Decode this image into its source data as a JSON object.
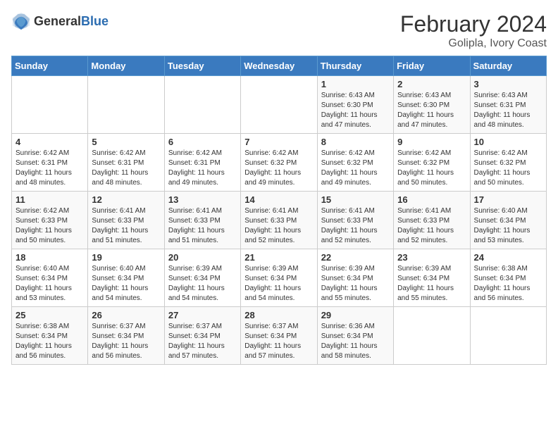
{
  "logo": {
    "general": "General",
    "blue": "Blue"
  },
  "title": "February 2024",
  "subtitle": "Golipla, Ivory Coast",
  "days_of_week": [
    "Sunday",
    "Monday",
    "Tuesday",
    "Wednesday",
    "Thursday",
    "Friday",
    "Saturday"
  ],
  "weeks": [
    [
      {
        "day": "",
        "sunrise": "",
        "sunset": "",
        "daylight": ""
      },
      {
        "day": "",
        "sunrise": "",
        "sunset": "",
        "daylight": ""
      },
      {
        "day": "",
        "sunrise": "",
        "sunset": "",
        "daylight": ""
      },
      {
        "day": "",
        "sunrise": "",
        "sunset": "",
        "daylight": ""
      },
      {
        "day": "1",
        "sunrise": "Sunrise: 6:43 AM",
        "sunset": "Sunset: 6:30 PM",
        "daylight": "Daylight: 11 hours and 47 minutes."
      },
      {
        "day": "2",
        "sunrise": "Sunrise: 6:43 AM",
        "sunset": "Sunset: 6:30 PM",
        "daylight": "Daylight: 11 hours and 47 minutes."
      },
      {
        "day": "3",
        "sunrise": "Sunrise: 6:43 AM",
        "sunset": "Sunset: 6:31 PM",
        "daylight": "Daylight: 11 hours and 48 minutes."
      }
    ],
    [
      {
        "day": "4",
        "sunrise": "Sunrise: 6:42 AM",
        "sunset": "Sunset: 6:31 PM",
        "daylight": "Daylight: 11 hours and 48 minutes."
      },
      {
        "day": "5",
        "sunrise": "Sunrise: 6:42 AM",
        "sunset": "Sunset: 6:31 PM",
        "daylight": "Daylight: 11 hours and 48 minutes."
      },
      {
        "day": "6",
        "sunrise": "Sunrise: 6:42 AM",
        "sunset": "Sunset: 6:31 PM",
        "daylight": "Daylight: 11 hours and 49 minutes."
      },
      {
        "day": "7",
        "sunrise": "Sunrise: 6:42 AM",
        "sunset": "Sunset: 6:32 PM",
        "daylight": "Daylight: 11 hours and 49 minutes."
      },
      {
        "day": "8",
        "sunrise": "Sunrise: 6:42 AM",
        "sunset": "Sunset: 6:32 PM",
        "daylight": "Daylight: 11 hours and 49 minutes."
      },
      {
        "day": "9",
        "sunrise": "Sunrise: 6:42 AM",
        "sunset": "Sunset: 6:32 PM",
        "daylight": "Daylight: 11 hours and 50 minutes."
      },
      {
        "day": "10",
        "sunrise": "Sunrise: 6:42 AM",
        "sunset": "Sunset: 6:32 PM",
        "daylight": "Daylight: 11 hours and 50 minutes."
      }
    ],
    [
      {
        "day": "11",
        "sunrise": "Sunrise: 6:42 AM",
        "sunset": "Sunset: 6:33 PM",
        "daylight": "Daylight: 11 hours and 50 minutes."
      },
      {
        "day": "12",
        "sunrise": "Sunrise: 6:41 AM",
        "sunset": "Sunset: 6:33 PM",
        "daylight": "Daylight: 11 hours and 51 minutes."
      },
      {
        "day": "13",
        "sunrise": "Sunrise: 6:41 AM",
        "sunset": "Sunset: 6:33 PM",
        "daylight": "Daylight: 11 hours and 51 minutes."
      },
      {
        "day": "14",
        "sunrise": "Sunrise: 6:41 AM",
        "sunset": "Sunset: 6:33 PM",
        "daylight": "Daylight: 11 hours and 52 minutes."
      },
      {
        "day": "15",
        "sunrise": "Sunrise: 6:41 AM",
        "sunset": "Sunset: 6:33 PM",
        "daylight": "Daylight: 11 hours and 52 minutes."
      },
      {
        "day": "16",
        "sunrise": "Sunrise: 6:41 AM",
        "sunset": "Sunset: 6:33 PM",
        "daylight": "Daylight: 11 hours and 52 minutes."
      },
      {
        "day": "17",
        "sunrise": "Sunrise: 6:40 AM",
        "sunset": "Sunset: 6:34 PM",
        "daylight": "Daylight: 11 hours and 53 minutes."
      }
    ],
    [
      {
        "day": "18",
        "sunrise": "Sunrise: 6:40 AM",
        "sunset": "Sunset: 6:34 PM",
        "daylight": "Daylight: 11 hours and 53 minutes."
      },
      {
        "day": "19",
        "sunrise": "Sunrise: 6:40 AM",
        "sunset": "Sunset: 6:34 PM",
        "daylight": "Daylight: 11 hours and 54 minutes."
      },
      {
        "day": "20",
        "sunrise": "Sunrise: 6:39 AM",
        "sunset": "Sunset: 6:34 PM",
        "daylight": "Daylight: 11 hours and 54 minutes."
      },
      {
        "day": "21",
        "sunrise": "Sunrise: 6:39 AM",
        "sunset": "Sunset: 6:34 PM",
        "daylight": "Daylight: 11 hours and 54 minutes."
      },
      {
        "day": "22",
        "sunrise": "Sunrise: 6:39 AM",
        "sunset": "Sunset: 6:34 PM",
        "daylight": "Daylight: 11 hours and 55 minutes."
      },
      {
        "day": "23",
        "sunrise": "Sunrise: 6:39 AM",
        "sunset": "Sunset: 6:34 PM",
        "daylight": "Daylight: 11 hours and 55 minutes."
      },
      {
        "day": "24",
        "sunrise": "Sunrise: 6:38 AM",
        "sunset": "Sunset: 6:34 PM",
        "daylight": "Daylight: 11 hours and 56 minutes."
      }
    ],
    [
      {
        "day": "25",
        "sunrise": "Sunrise: 6:38 AM",
        "sunset": "Sunset: 6:34 PM",
        "daylight": "Daylight: 11 hours and 56 minutes."
      },
      {
        "day": "26",
        "sunrise": "Sunrise: 6:37 AM",
        "sunset": "Sunset: 6:34 PM",
        "daylight": "Daylight: 11 hours and 56 minutes."
      },
      {
        "day": "27",
        "sunrise": "Sunrise: 6:37 AM",
        "sunset": "Sunset: 6:34 PM",
        "daylight": "Daylight: 11 hours and 57 minutes."
      },
      {
        "day": "28",
        "sunrise": "Sunrise: 6:37 AM",
        "sunset": "Sunset: 6:34 PM",
        "daylight": "Daylight: 11 hours and 57 minutes."
      },
      {
        "day": "29",
        "sunrise": "Sunrise: 6:36 AM",
        "sunset": "Sunset: 6:34 PM",
        "daylight": "Daylight: 11 hours and 58 minutes."
      },
      {
        "day": "",
        "sunrise": "",
        "sunset": "",
        "daylight": ""
      },
      {
        "day": "",
        "sunrise": "",
        "sunset": "",
        "daylight": ""
      }
    ]
  ]
}
